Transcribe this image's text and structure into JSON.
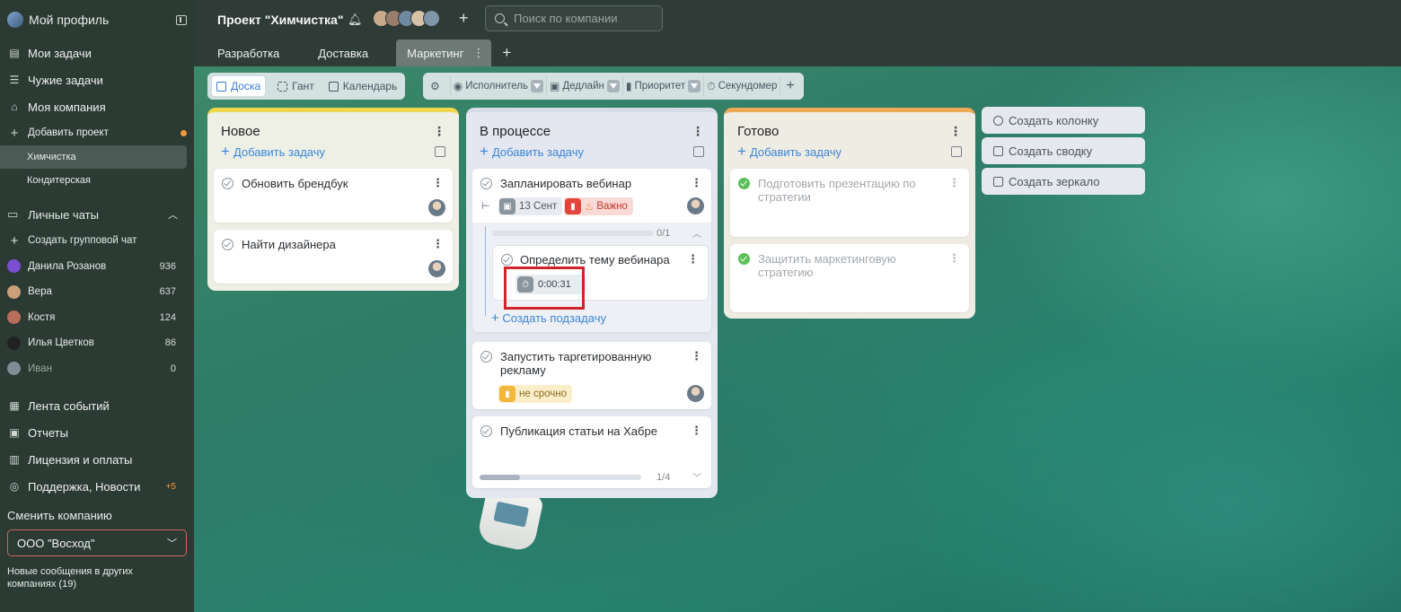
{
  "sidebar": {
    "profile": "Мой профиль",
    "nav": [
      {
        "label": "Мои задачи",
        "icon": "tasks-icon"
      },
      {
        "label": "Чужие задачи",
        "icon": "list-icon"
      },
      {
        "label": "Моя компания",
        "icon": "company-icon"
      }
    ],
    "add_project": "Добавить проект",
    "projects": [
      "Химчистка",
      "Кондитерская"
    ],
    "personal_chats": "Личные чаты",
    "create_group_chat": "Создать групповой чат",
    "chats": [
      {
        "name": "Данила Розанов",
        "count": "936"
      },
      {
        "name": "Вера",
        "count": "637"
      },
      {
        "name": "Костя",
        "count": "124"
      },
      {
        "name": "Илья Цветков",
        "count": "86"
      },
      {
        "name": "Иван",
        "count": "0"
      }
    ],
    "bottom_nav": [
      {
        "label": "Лента событий"
      },
      {
        "label": "Отчеты"
      },
      {
        "label": "Лицензия и оплаты"
      },
      {
        "label": "Поддержка, Новости",
        "badge": "+5"
      }
    ],
    "switch_company_label": "Сменить компанию",
    "company_select": "ООО \"Восход\"",
    "news_line1": "Новые сообщения в других",
    "news_line2": "компаниях (19)"
  },
  "header": {
    "project_title": "Проект \"Химчистка\"",
    "search_placeholder": "Поиск по компании",
    "tabs": [
      "Разработка",
      "Доставка",
      "Маркетинг"
    ]
  },
  "viewbar": {
    "board": "Доска",
    "gantt": "Гант",
    "calendar": "Календарь"
  },
  "filters": {
    "assignee": "Исполнитель",
    "deadline": "Дедлайн",
    "priority": "Приоритет",
    "stopwatch": "Секундомер"
  },
  "columns": {
    "new": {
      "title": "Новое",
      "add_task": "Добавить задачу",
      "cards": [
        "Обновить брендбук",
        "Найти дизайнера"
      ]
    },
    "progress": {
      "title": "В процессе",
      "add_task": "Добавить задачу",
      "card1": {
        "title": "Запланировать вебинар",
        "date": "13 Сент",
        "priority": "Важно",
        "subtasks_counter": "0/1",
        "subtasks_fraction": 0,
        "subtask_title": "Определить тему вебинара",
        "timer": "0:00:31",
        "create_subtask": "Создать подзадачу"
      },
      "card2": {
        "title": "Запустить таргетированную рекламу",
        "priority": "не срочно"
      },
      "card3": {
        "title": "Публикация статьи на Хабре",
        "counter": "1/4",
        "fraction": 0.25
      }
    },
    "done": {
      "title": "Готово",
      "add_task": "Добавить задачу",
      "cards": [
        "Подготовить презентацию по стратегии",
        "Защитить маркетинговую стратегию"
      ]
    }
  },
  "side_buttons": {
    "create_column": "Создать колонку",
    "create_summary": "Создать сводку",
    "create_mirror": "Создать зеркало"
  }
}
